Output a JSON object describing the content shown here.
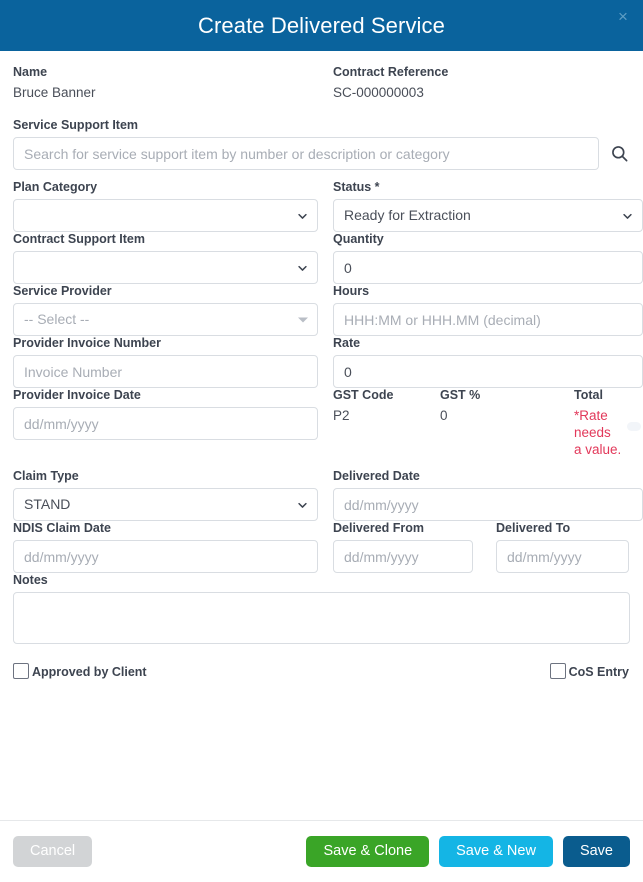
{
  "header": {
    "title": "Create Delivered Service",
    "close_label": "×",
    "accent_color": "#0a639d"
  },
  "summary": {
    "name_label": "Name",
    "name_value": "Bruce Banner",
    "contract_reference_label": "Contract Reference",
    "contract_reference_value": "SC-000000003"
  },
  "form": {
    "service_support_item": {
      "label": "Service Support Item",
      "value": "",
      "placeholder": "Search for service support item by number or description or category",
      "search_icon": "search-icon"
    },
    "plan_category": {
      "label": "Plan Category",
      "value": "",
      "options": [
        ""
      ]
    },
    "status": {
      "label": "Status *",
      "value": "Ready for Extraction",
      "options": [
        "Ready for Extraction"
      ]
    },
    "contract_support_item": {
      "label": "Contract Support Item",
      "value": "",
      "options": [
        ""
      ]
    },
    "quantity": {
      "label": "Quantity",
      "value": "0",
      "placeholder": ""
    },
    "service_provider": {
      "label": "Service Provider",
      "value": "-- Select --",
      "options": [
        "-- Select --"
      ]
    },
    "hours": {
      "label": "Hours",
      "value": "",
      "placeholder": "HHH:MM or HHH.MM (decimal)"
    },
    "provider_invoice_number": {
      "label": "Provider Invoice Number",
      "value": "",
      "placeholder": "Invoice Number"
    },
    "rate": {
      "label": "Rate",
      "value": "0",
      "placeholder": ""
    },
    "provider_invoice_date": {
      "label": "Provider Invoice Date",
      "value": "",
      "placeholder": "dd/mm/yyyy"
    },
    "gst_code": {
      "label": "GST Code",
      "value": "P2"
    },
    "gst_percent": {
      "label": "GST %",
      "value": "0"
    },
    "total": {
      "label": "Total",
      "error_line1": "*Rate needs",
      "error_line2": "a value.",
      "error_color": "#e2385a"
    },
    "claim_type": {
      "label": "Claim Type",
      "value": "STAND",
      "options": [
        "STAND"
      ]
    },
    "delivered_date": {
      "label": "Delivered Date",
      "value": "",
      "placeholder": "dd/mm/yyyy"
    },
    "ndis_claim_date": {
      "label": "NDIS Claim Date",
      "value": "",
      "placeholder": "dd/mm/yyyy"
    },
    "delivered_from": {
      "label": "Delivered From",
      "value": "",
      "placeholder": "dd/mm/yyyy"
    },
    "delivered_to": {
      "label": "Delivered To",
      "value": "",
      "placeholder": "dd/mm/yyyy"
    },
    "notes": {
      "label": "Notes",
      "value": "",
      "placeholder": ""
    },
    "approved_by_client": {
      "label": "Approved by Client",
      "checked": false
    },
    "cos_entry": {
      "label": "CoS Entry",
      "checked": false
    }
  },
  "footer": {
    "cancel_label": "Cancel",
    "save_clone_label": "Save & Clone",
    "save_new_label": "Save & New",
    "save_label": "Save",
    "cancel_color": "#d2d4d6",
    "save_clone_color": "#3aa527",
    "save_new_color": "#14b5e5",
    "save_color": "#0a5c8e"
  }
}
